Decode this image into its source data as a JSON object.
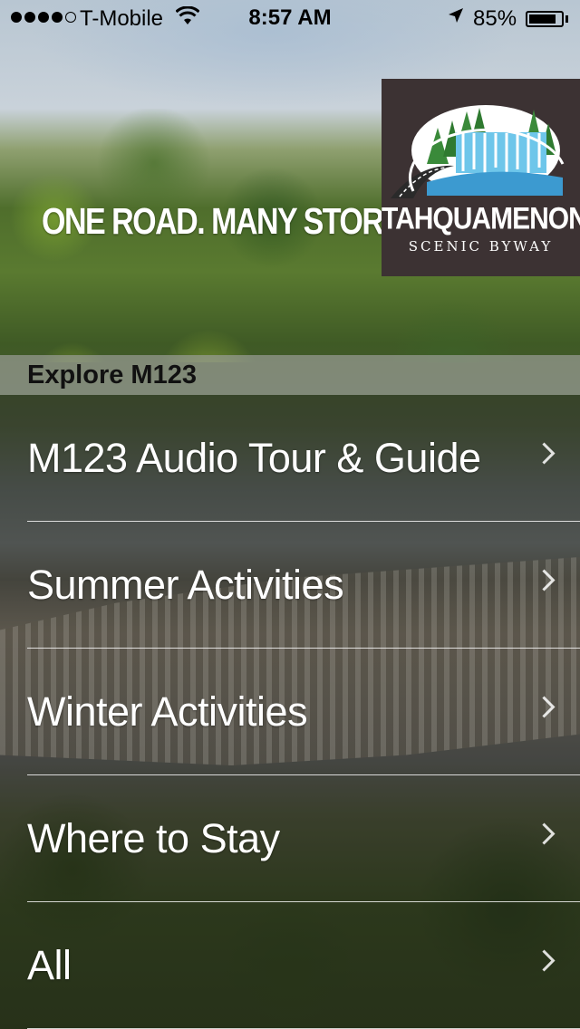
{
  "status_bar": {
    "carrier": "T-Mobile",
    "time": "8:57 AM",
    "battery_percent": "85%",
    "battery_level": 0.85,
    "signal_bars_filled": 4,
    "signal_bars_total": 5
  },
  "header": {
    "tagline": "ONE ROAD. MANY STORIES.",
    "logo": {
      "title": "TAHQUAMENON",
      "subtitle": "SCENIC BYWAY"
    }
  },
  "section": {
    "title": "Explore M123"
  },
  "menu": {
    "items": [
      {
        "label": "M123 Audio Tour & Guide",
        "icon": "chevron-right-icon"
      },
      {
        "label": "Summer Activities",
        "icon": "chevron-right-icon"
      },
      {
        "label": "Winter Activities",
        "icon": "chevron-right-icon"
      },
      {
        "label": "Where to Stay",
        "icon": "chevron-right-icon"
      },
      {
        "label": "All",
        "icon": "chevron-right-icon"
      }
    ]
  },
  "colors": {
    "logo_background": "#3c3233",
    "menu_text": "#ffffff",
    "section_header_bg": "#bec3b9"
  }
}
